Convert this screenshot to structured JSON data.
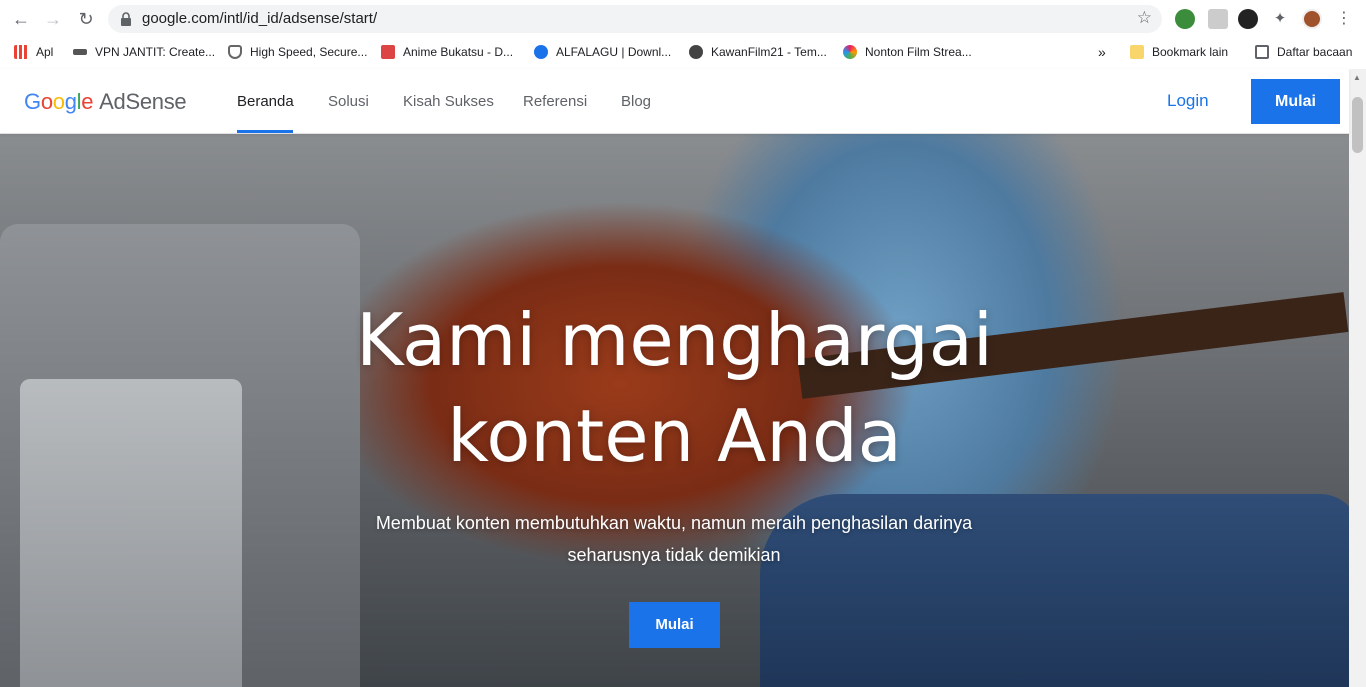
{
  "browser": {
    "url": "google.com/intl/id_id/adsense/start/",
    "bookmarks": [
      {
        "label": "Apl",
        "icon": "apps-grid-icon",
        "color": "#ea4335"
      },
      {
        "label": "VPN JANTIT: Create...",
        "icon": "vpn-icon",
        "color": "#555555"
      },
      {
        "label": "High Speed, Secure...",
        "icon": "shield-icon",
        "color": "#666666"
      },
      {
        "label": "Anime Bukatsu - D...",
        "icon": "anime-icon",
        "color": "#d44"
      },
      {
        "label": "ALFALAGU | Downl...",
        "icon": "music-icon",
        "color": "#1a73e8"
      },
      {
        "label": "KawanFilm21 - Tem...",
        "icon": "globe-icon",
        "color": "#444444"
      },
      {
        "label": "Nonton Film Strea...",
        "icon": "pinwheel-icon",
        "color": "#e91e63"
      }
    ],
    "more_bookmarks": "»",
    "other_bookmarks": "Bookmark lain",
    "reading_list": "Daftar bacaan"
  },
  "site": {
    "logo_google": [
      "G",
      "o",
      "o",
      "g",
      "l",
      "e"
    ],
    "logo_product": "AdSense",
    "nav": [
      "Beranda",
      "Solusi",
      "Kisah Sukses",
      "Referensi",
      "Blog"
    ],
    "login": "Login",
    "cta_top": "Mulai"
  },
  "hero": {
    "title_line1": "Kami menghargai",
    "title_line2": "konten Anda",
    "subtitle_line1": "Membuat konten membutuhkan waktu, namun meraih penghasilan darinya",
    "subtitle_line2": "seharusnya tidak demikian",
    "cta": "Mulai"
  },
  "colors": {
    "accent": "#1a73e8",
    "text_dark": "#202124",
    "text_muted": "#5f6368"
  }
}
